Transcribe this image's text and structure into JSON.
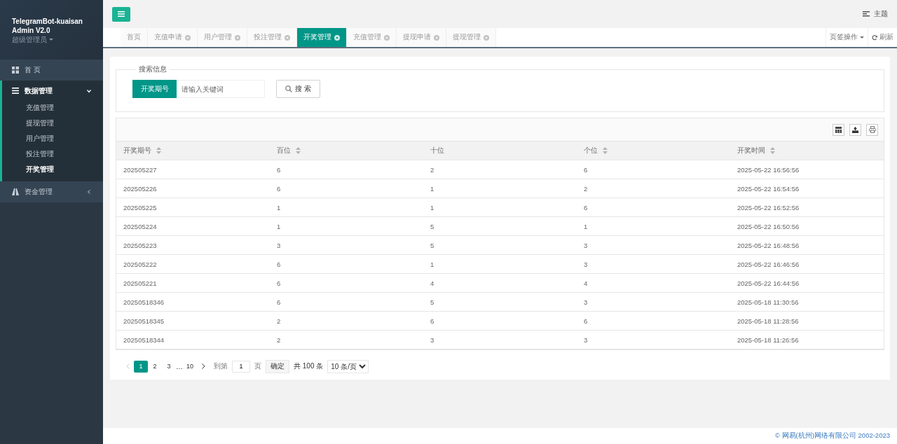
{
  "sidebar": {
    "brand": [
      "TelegramBot-kuaisan",
      "Admin V2.0"
    ],
    "user": "超级管理员",
    "menu": [
      {
        "label": "首 页",
        "expanded": false
      },
      {
        "label": "数据管理",
        "expanded": true,
        "children": [
          {
            "label": "充值管理",
            "selected": false
          },
          {
            "label": "提现管理",
            "selected": false
          },
          {
            "label": "用户管理",
            "selected": false
          },
          {
            "label": "投注管理",
            "selected": false
          },
          {
            "label": "开奖管理",
            "selected": true
          }
        ]
      },
      {
        "label": "资金管理",
        "expanded": false
      }
    ]
  },
  "header": {
    "theme": "主题"
  },
  "tabs": [
    {
      "label": "首页",
      "closable": false,
      "selected": false
    },
    {
      "label": "充值申请",
      "closable": true,
      "selected": false
    },
    {
      "label": "用户管理",
      "closable": true,
      "selected": false
    },
    {
      "label": "投注管理",
      "closable": true,
      "selected": false
    },
    {
      "label": "开奖管理",
      "closable": true,
      "selected": true
    },
    {
      "label": "充值管理",
      "closable": true,
      "selected": false
    },
    {
      "label": "提现申请",
      "closable": true,
      "selected": false
    },
    {
      "label": "提现管理",
      "closable": true,
      "selected": false
    }
  ],
  "tab_actions": {
    "menu": "页签操作",
    "refresh": "刷新"
  },
  "search": {
    "legend": "搜索信息",
    "field_label": "开奖期号",
    "placeholder": "请输入关键词",
    "button": "搜 索"
  },
  "table": {
    "columns": [
      {
        "label": "开奖期号",
        "sortable": true
      },
      {
        "label": "百位",
        "sortable": true
      },
      {
        "label": "十位",
        "sortable": false
      },
      {
        "label": "个位",
        "sortable": true
      },
      {
        "label": "开奖时间",
        "sortable": true
      }
    ],
    "rows": [
      [
        "202505227",
        "6",
        "2",
        "6",
        "2025-05-22 16:56:56"
      ],
      [
        "202505226",
        "6",
        "1",
        "2",
        "2025-05-22 16:54:56"
      ],
      [
        "202505225",
        "1",
        "1",
        "6",
        "2025-05-22 16:52:56"
      ],
      [
        "202505224",
        "1",
        "5",
        "1",
        "2025-05-22 16:50:56"
      ],
      [
        "202505223",
        "3",
        "5",
        "3",
        "2025-05-22 16:48:56"
      ],
      [
        "202505222",
        "6",
        "1",
        "3",
        "2025-05-22 16:46:56"
      ],
      [
        "202505221",
        "6",
        "4",
        "4",
        "2025-05-22 16:44:56"
      ],
      [
        "20250518346",
        "6",
        "5",
        "3",
        "2025-05-18 11:30:56"
      ],
      [
        "20250518345",
        "2",
        "6",
        "6",
        "2025-05-18 11:28:56"
      ],
      [
        "20250518344",
        "2",
        "3",
        "3",
        "2025-05-18 11:26:56"
      ]
    ]
  },
  "pagination": {
    "pages": [
      {
        "label": "1",
        "selected": true
      },
      {
        "label": "2",
        "selected": false
      },
      {
        "label": "3",
        "selected": false
      }
    ],
    "ellipsis": "…",
    "last": "10",
    "goto_label": "到第",
    "goto_value": "1",
    "page_unit": "页",
    "confirm": "确定",
    "total": "共 100 条",
    "page_size": "10 条/页"
  },
  "footer": "© 网易(杭州)网络有限公司 2002-2023"
}
